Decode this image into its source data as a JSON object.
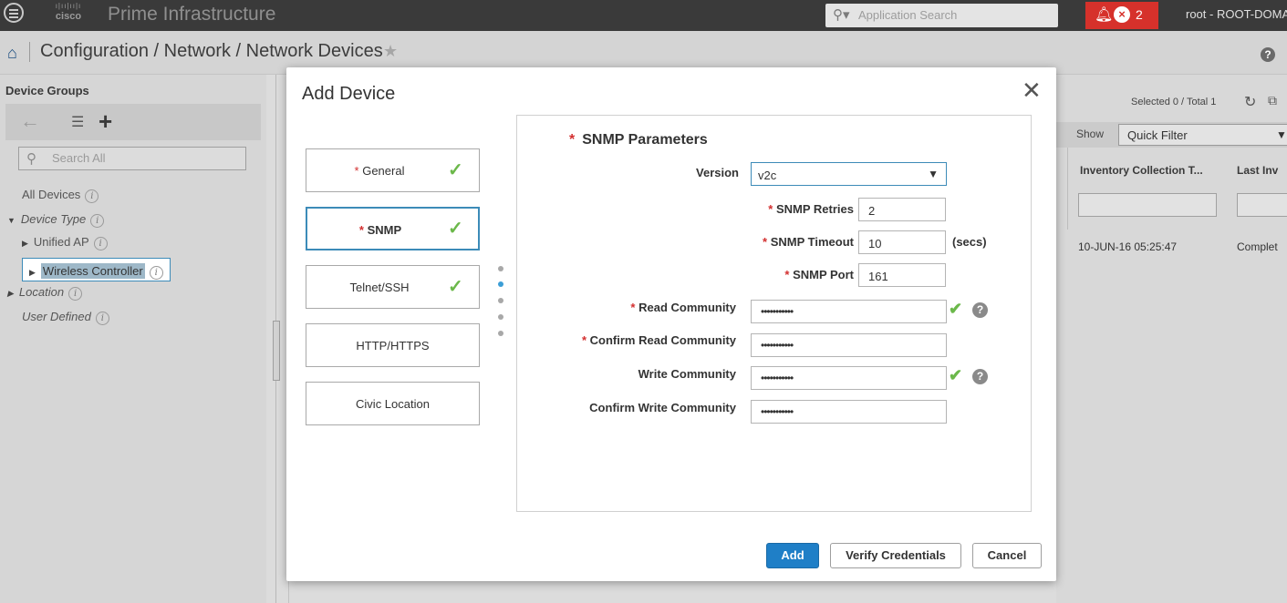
{
  "header": {
    "logo_text": "cisco",
    "product": "Prime Infrastructure",
    "search_placeholder": "Application Search",
    "alarm_count": "2",
    "user": "root - ROOT-DOMAIN"
  },
  "breadcrumb": {
    "text": "Configuration / Network / Network Devices"
  },
  "left_panel": {
    "title": "Device Groups",
    "search_placeholder": "Search All",
    "tree": [
      {
        "label": "All Devices"
      },
      {
        "label": "Device Type"
      },
      {
        "label": "Unified AP"
      },
      {
        "label": "Wireless Controller"
      },
      {
        "label": "Location"
      },
      {
        "label": "User Defined"
      }
    ]
  },
  "table": {
    "selected_total": "Selected 0 / Total 1",
    "show_label": "Show",
    "filter_value": "Quick Filter",
    "columns": [
      "Inventory Collection T...",
      "Last Inv"
    ],
    "row": [
      "10-JUN-16 05:25:47",
      "Complet"
    ]
  },
  "modal": {
    "title": "Add Device",
    "steps": [
      {
        "label": "General",
        "required": "*"
      },
      {
        "label": "SNMP",
        "required": "*"
      },
      {
        "label": "Telnet/SSH"
      },
      {
        "label": "HTTP/HTTPS"
      },
      {
        "label": "Civic Location"
      }
    ],
    "section_title": "SNMP Parameters",
    "fields": {
      "version": {
        "label": "Version",
        "value": "v2c"
      },
      "retries": {
        "label": "SNMP Retries",
        "value": "2"
      },
      "timeout": {
        "label": "SNMP Timeout",
        "value": "10",
        "unit": "(secs)"
      },
      "port": {
        "label": "SNMP Port",
        "value": "161"
      },
      "read_community": {
        "label": "Read Community",
        "value": "•••••••••••"
      },
      "confirm_read_community": {
        "label": "Confirm Read Community",
        "value": "•••••••••••"
      },
      "write_community": {
        "label": "Write Community",
        "value": "•••••••••••"
      },
      "confirm_write_community": {
        "label": "Confirm Write Community",
        "value": "•••••••••••"
      }
    },
    "buttons": {
      "add": "Add",
      "verify": "Verify Credentials",
      "cancel": "Cancel"
    }
  },
  "colors": {
    "accent": "#1f7fc7",
    "required": "#d32f2f",
    "valid": "#6bb84a",
    "alarm": "#d6312b"
  }
}
